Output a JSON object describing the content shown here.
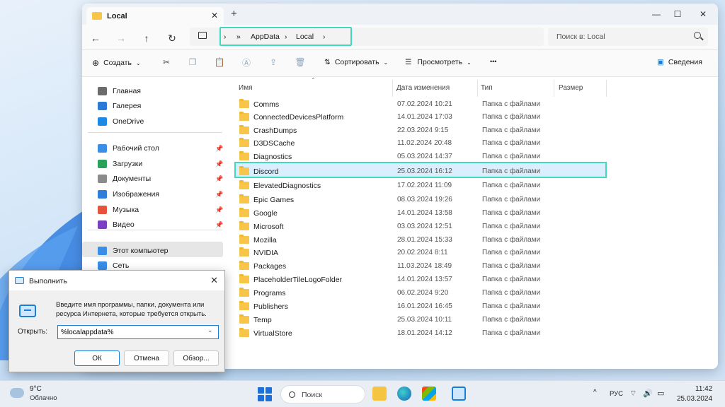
{
  "explorer": {
    "tab_title": "Local",
    "address": {
      "crumbs": [
        "AppData",
        "Local"
      ]
    },
    "search_placeholder": "Поиск в: Local",
    "commands": {
      "create": "Создать",
      "sort": "Сортировать",
      "view": "Просмотреть",
      "more": "•••",
      "details": "Сведения"
    },
    "sidebar": {
      "items": [
        {
          "label": "Главная",
          "icon": "home-icon",
          "color": "#6b6b6b"
        },
        {
          "label": "Галерея",
          "icon": "gallery-icon",
          "color": "#2b7bd6"
        },
        {
          "label": "OneDrive",
          "icon": "onedrive-icon",
          "color": "#1e88e5"
        },
        {
          "label": "Рабочий стол",
          "icon": "desktop-icon",
          "color": "#3a8ee6"
        },
        {
          "label": "Загрузки",
          "icon": "downloads-icon",
          "color": "#2aa15a"
        },
        {
          "label": "Документы",
          "icon": "documents-icon",
          "color": "#8b8b8b"
        },
        {
          "label": "Изображения",
          "icon": "pictures-icon",
          "color": "#2f7ed8"
        },
        {
          "label": "Музыка",
          "icon": "music-icon",
          "color": "#e5533d"
        },
        {
          "label": "Видео",
          "icon": "videos-icon",
          "color": "#7b3fc4"
        },
        {
          "label": "Этот компьютер",
          "icon": "this-pc-icon",
          "color": "#3a8ee6"
        },
        {
          "label": "Сеть",
          "icon": "network-icon",
          "color": "#3a8ee6"
        }
      ]
    },
    "columns": {
      "name": "Имя",
      "date": "Дата изменения",
      "type": "Тип",
      "size": "Размер"
    },
    "files": [
      {
        "name": "Comms",
        "date": "07.02.2024 10:21",
        "type": "Папка с файлами"
      },
      {
        "name": "ConnectedDevicesPlatform",
        "date": "14.01.2024 17:03",
        "type": "Папка с файлами"
      },
      {
        "name": "CrashDumps",
        "date": "22.03.2024 9:15",
        "type": "Папка с файлами"
      },
      {
        "name": "D3DSCache",
        "date": "11.02.2024 20:48",
        "type": "Папка с файлами"
      },
      {
        "name": "Diagnostics",
        "date": "05.03.2024 14:37",
        "type": "Папка с файлами"
      },
      {
        "name": "Discord",
        "date": "25.03.2024 16:12",
        "type": "Папка с файлами"
      },
      {
        "name": "ElevatedDiagnostics",
        "date": "17.02.2024 11:09",
        "type": "Папка с файлами"
      },
      {
        "name": "Epic Games",
        "date": "08.03.2024 19:26",
        "type": "Папка с файлами"
      },
      {
        "name": "Google",
        "date": "14.01.2024 13:58",
        "type": "Папка с файлами"
      },
      {
        "name": "Microsoft",
        "date": "03.03.2024 12:51",
        "type": "Папка с файлами"
      },
      {
        "name": "Mozilla",
        "date": "28.01.2024 15:33",
        "type": "Папка с файлами"
      },
      {
        "name": "NVIDIA",
        "date": "20.02.2024 8:11",
        "type": "Папка с файлами"
      },
      {
        "name": "Packages",
        "date": "11.03.2024 18:49",
        "type": "Папка с файлами"
      },
      {
        "name": "PlaceholderTileLogoFolder",
        "date": "14.01.2024 13:57",
        "type": "Папка с файлами"
      },
      {
        "name": "Programs",
        "date": "06.02.2024 9:20",
        "type": "Папка с файлами"
      },
      {
        "name": "Publishers",
        "date": "16.01.2024 16:45",
        "type": "Папка с файлами"
      },
      {
        "name": "Temp",
        "date": "25.03.2024 10:11",
        "type": "Папка с файлами"
      },
      {
        "name": "VirtualStore",
        "date": "18.01.2024 14:12",
        "type": "Папка с файлами"
      }
    ]
  },
  "run_dialog": {
    "title": "Выполнить",
    "description": "Введите имя программы, папки, документа или ресурса Интернета, которые требуется открыть.",
    "open_label": "Открыть:",
    "input_value": "%localappdata%",
    "buttons": {
      "ok": "ОК",
      "cancel": "Отмена",
      "browse": "Обзор..."
    }
  },
  "taskbar": {
    "weather": {
      "temp": "9°C",
      "desc": "Облачно"
    },
    "search": "Поиск",
    "tray": {
      "lang": "РУС"
    },
    "clock": {
      "time": "11:42",
      "date": "25.03.2024"
    }
  },
  "colors": {
    "highlight": "#3fd9c0",
    "accent": "#1a7fd4",
    "folder": "#f7c548"
  }
}
